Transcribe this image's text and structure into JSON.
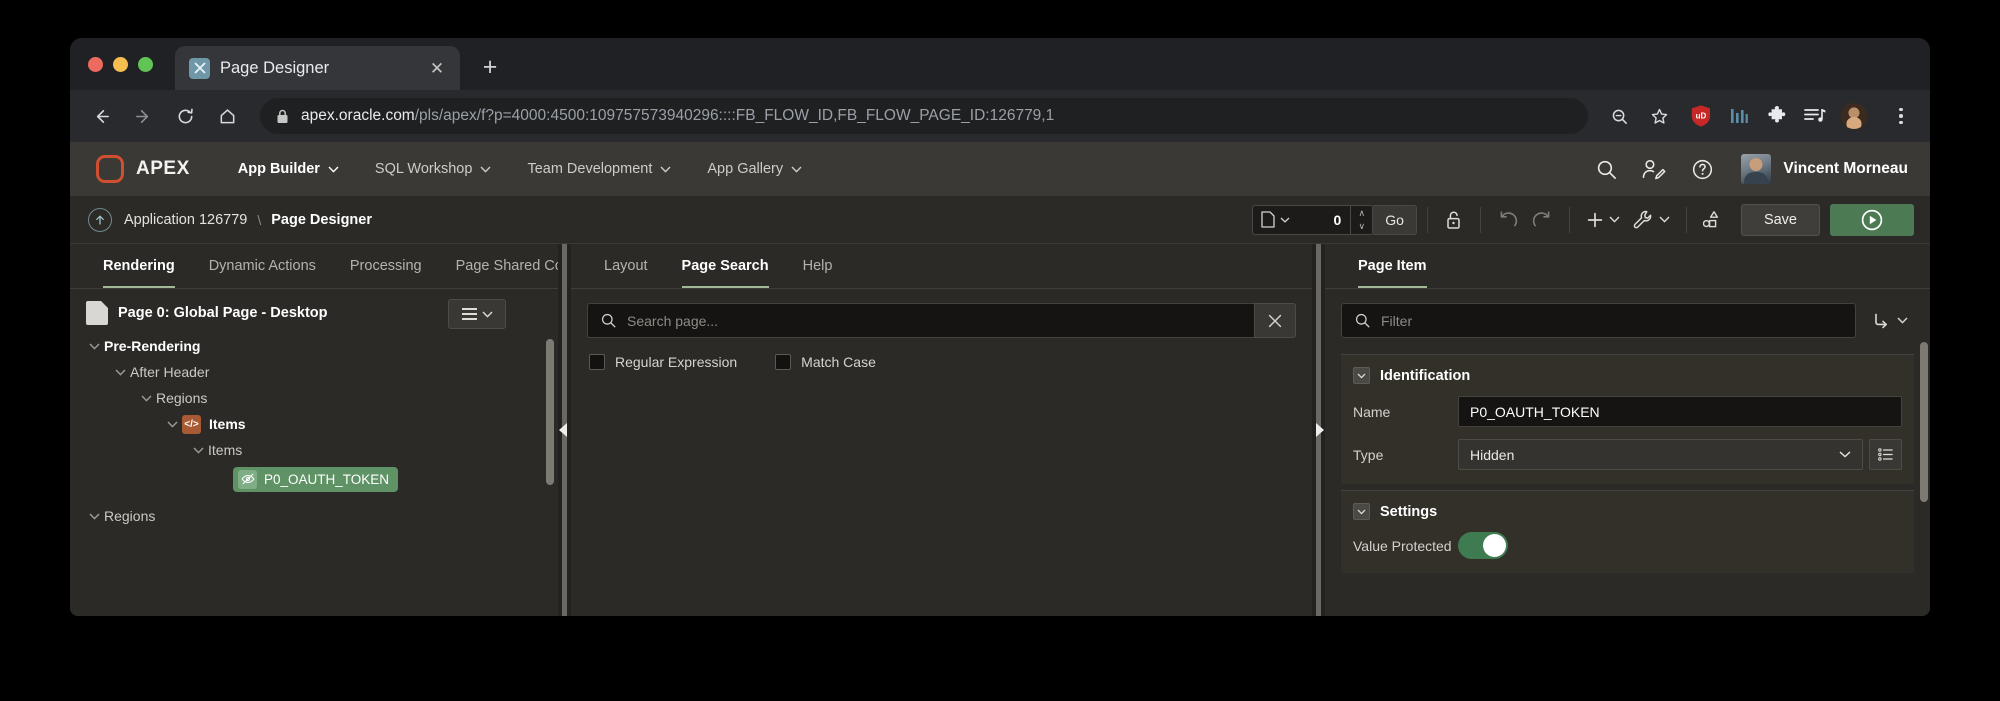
{
  "browser": {
    "tab": {
      "title": "Page Designer",
      "favicon_icon": "apex-favicon-icon",
      "close_icon": "close-icon"
    },
    "new_tab_label": "+",
    "nav": {
      "back_icon": "back-arrow-icon",
      "forward_icon": "forward-arrow-icon",
      "reload_icon": "reload-icon",
      "home_icon": "home-icon"
    },
    "omnibox": {
      "lock_icon": "lock-icon",
      "url_domain": "apex.oracle.com",
      "url_path": "/pls/apex/f?p=4000:4500:109757573940296::::FB_FLOW_ID,FB_FLOW_PAGE_ID:126779,1",
      "zoom_icon": "zoom-out-icon",
      "bookmark_icon": "star-icon"
    },
    "extensions": [
      {
        "name": "ublock-origin-icon",
        "label": "uD",
        "color": "#c62828"
      },
      {
        "name": "bar-chart-extension-icon",
        "color": "#5b8fa8"
      },
      {
        "name": "puzzle-extensions-icon",
        "color": "#e8eaed"
      },
      {
        "name": "media-playlist-icon",
        "color": "#e8eaed"
      }
    ],
    "profile_icon": "profile-avatar-icon",
    "menu_icon": "kebab-menu-icon"
  },
  "apex_header": {
    "logo_icon": "apex-logo-icon",
    "brand": "APEX",
    "nav": [
      {
        "label": "App Builder",
        "active": true,
        "chevron": "chevron-down-icon"
      },
      {
        "label": "SQL Workshop",
        "active": false,
        "chevron": "chevron-down-icon"
      },
      {
        "label": "Team Development",
        "active": false,
        "chevron": "chevron-down-icon"
      },
      {
        "label": "App Gallery",
        "active": false,
        "chevron": "chevron-down-icon"
      }
    ],
    "actions": [
      {
        "name": "search-icon"
      },
      {
        "name": "account-settings-icon"
      },
      {
        "name": "help-icon"
      }
    ],
    "user": {
      "name": "Vincent Morneau",
      "avatar_icon": "user-avatar"
    }
  },
  "breadcrumb": {
    "up_icon": "arrow-up-icon",
    "application": "Application 126779",
    "separator": "\\",
    "current": "Page Designer"
  },
  "toolbar": {
    "page_select_icon": "page-document-icon",
    "page_number": "0",
    "spinner_up": "∧",
    "spinner_down": "∨",
    "go_label": "Go",
    "lock_icon": "unlock-icon",
    "undo_icon": "undo-icon",
    "redo_icon": "redo-icon",
    "create_icon": "plus-icon",
    "utilities_icon": "wrench-icon",
    "shapes_icon": "page-shapes-icon",
    "save_label": "Save",
    "run_icon": "play-circle-icon"
  },
  "left_panel": {
    "tabs": [
      {
        "label": "Rendering",
        "active": true
      },
      {
        "label": "Dynamic Actions",
        "active": false
      },
      {
        "label": "Processing",
        "active": false
      },
      {
        "label": "Page Shared Component",
        "active": false
      }
    ],
    "page_icon": "page-document-icon",
    "page_title": "Page 0: Global Page - Desktop",
    "menu_button_icon": "hamburger-menu-icon",
    "menu_chevron_icon": "chevron-down-icon",
    "tree": [
      {
        "label": "Pre-Rendering",
        "indent": 0,
        "bold": true,
        "twisty": "chevron-down-icon",
        "kind": "plain"
      },
      {
        "label": "After Header",
        "indent": 1,
        "bold": false,
        "twisty": "chevron-down-icon",
        "kind": "plain"
      },
      {
        "label": "Regions",
        "indent": 2,
        "bold": false,
        "twisty": "chevron-down-icon",
        "kind": "plain"
      },
      {
        "label": "Items",
        "indent": 3,
        "bold": true,
        "twisty": "chevron-down-icon",
        "kind": "code",
        "icon": "code-region-icon",
        "icon_glyph": "</>"
      },
      {
        "label": "Items",
        "indent": 4,
        "bold": false,
        "twisty": "chevron-down-icon",
        "kind": "plain"
      },
      {
        "label": "P0_OAUTH_TOKEN",
        "indent": 5,
        "bold": false,
        "twisty": "",
        "kind": "selected",
        "icon": "hidden-item-eye-icon"
      },
      {
        "label": "Regions",
        "indent": 0,
        "bold": false,
        "twisty": "chevron-down-icon",
        "kind": "plain"
      }
    ]
  },
  "middle_panel": {
    "tabs": [
      {
        "label": "Layout",
        "active": false
      },
      {
        "label": "Page Search",
        "active": true
      },
      {
        "label": "Help",
        "active": false
      }
    ],
    "search": {
      "icon": "search-icon",
      "placeholder": "Search page...",
      "value": "",
      "clear_icon": "close-icon"
    },
    "options": [
      {
        "label": "Regular Expression",
        "checked": false
      },
      {
        "label": "Match Case",
        "checked": false
      }
    ]
  },
  "right_panel": {
    "tabs": [
      {
        "label": "Page Item",
        "active": true
      }
    ],
    "filter": {
      "icon": "search-icon",
      "placeholder": "Filter",
      "value": "",
      "menu_icon": "go-to-group-icon",
      "menu_chevron_icon": "chevron-down-icon"
    },
    "sections": [
      {
        "title": "Identification",
        "toggle_icon": "collapse-chevron-icon",
        "fields": [
          {
            "label": "Name",
            "type": "text",
            "value": "P0_OAUTH_TOKEN"
          },
          {
            "label": "Type",
            "type": "select",
            "value": "Hidden",
            "chevron": "chevron-down-icon",
            "lov_icon": "list-of-values-icon"
          }
        ]
      },
      {
        "title": "Settings",
        "toggle_icon": "collapse-chevron-icon",
        "fields": [
          {
            "label": "Value Protected",
            "type": "toggle",
            "value": "on"
          }
        ]
      }
    ]
  },
  "splitters": {
    "left_arrow_icon": "collapse-left-icon",
    "right_arrow_icon": "expand-right-icon"
  },
  "colors": {
    "accent_green": "#a3b894",
    "run_green": "#4b7a53",
    "selected_chip": "#5f9366",
    "apex_orange": "#cf4f30",
    "code_icon": "#a75a33"
  }
}
